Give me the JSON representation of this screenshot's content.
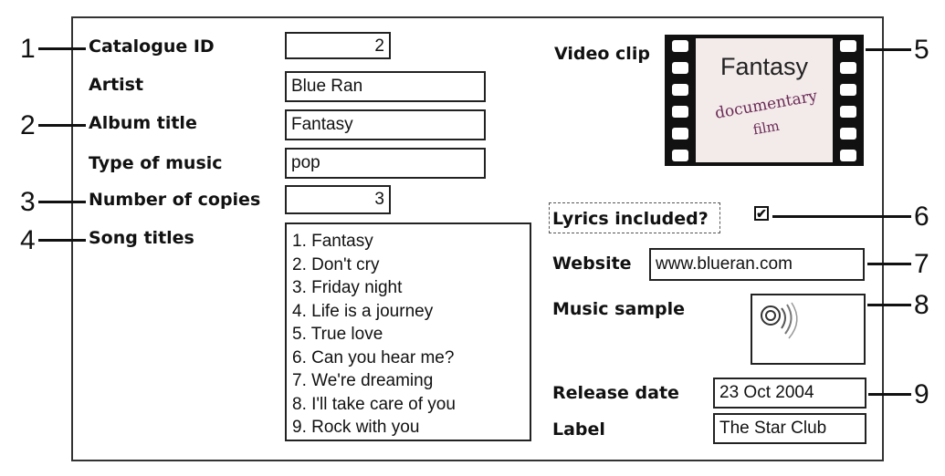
{
  "form": {
    "catalogue_id": {
      "label": "Catalogue ID",
      "value": "2"
    },
    "artist": {
      "label": "Artist",
      "value": "Blue Ran"
    },
    "album_title": {
      "label": "Album title",
      "value": "Fantasy"
    },
    "type_of_music": {
      "label": "Type of music",
      "value": "pop"
    },
    "number_of_copies": {
      "label": "Number of copies",
      "value": "3"
    },
    "song_titles": {
      "label": "Song titles",
      "items": [
        "1. Fantasy",
        "2. Don't cry",
        "3. Friday night",
        "4. Life is a journey",
        "5. True love",
        "6. Can you hear me?",
        "7. We're dreaming",
        "8. I'll take care of you",
        "9. Rock with you"
      ]
    },
    "video_clip": {
      "label": "Video clip",
      "title": "Fantasy",
      "subtitle_line1": "documentary",
      "subtitle_line2": "film"
    },
    "lyrics_included": {
      "label": "Lyrics included?",
      "checked": true,
      "mark": "✔"
    },
    "website": {
      "label": "Website",
      "value": "www.blueran.com"
    },
    "music_sample": {
      "label": "Music sample",
      "icon": "speaker-icon"
    },
    "release_date": {
      "label": "Release date",
      "value": "23 Oct 2004"
    },
    "record_label": {
      "label": "Label",
      "value": "The Star Club"
    }
  },
  "markers": {
    "m1": "1",
    "m2": "2",
    "m3": "3",
    "m4": "4",
    "m5": "5",
    "m6": "6",
    "m7": "7",
    "m8": "8",
    "m9": "9"
  }
}
